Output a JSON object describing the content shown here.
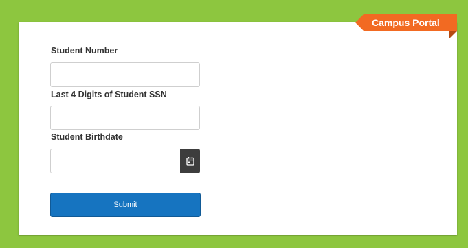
{
  "portal": {
    "ribbon_label": "Campus Portal"
  },
  "form": {
    "student_number": {
      "label": "Student Number",
      "value": ""
    },
    "ssn_last4": {
      "label": "Last 4 Digits of Student SSN",
      "value": ""
    },
    "birthdate": {
      "label": "Student Birthdate",
      "value": ""
    },
    "submit_label": "Submit"
  },
  "colors": {
    "page_background": "#8dc63f",
    "card_background": "#ffffff",
    "ribbon": "#f26a22",
    "submit_button": "#1674c0",
    "calendar_button": "#3d3d3d"
  },
  "icons": {
    "calendar_button": "calendar-icon"
  }
}
